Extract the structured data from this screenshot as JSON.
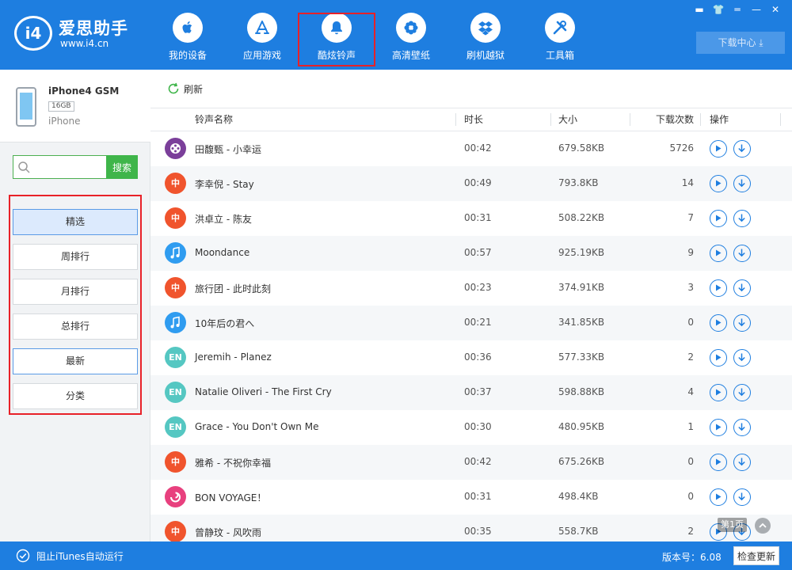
{
  "brand": {
    "badge": "i4",
    "name": "爱思助手",
    "url": "www.i4.cn"
  },
  "nav": [
    {
      "label": "我的设备",
      "icon": "apple-icon"
    },
    {
      "label": "应用游戏",
      "icon": "app-store-icon"
    },
    {
      "label": "酷炫铃声",
      "icon": "bell-icon",
      "active": true
    },
    {
      "label": "高清壁纸",
      "icon": "flower-icon"
    },
    {
      "label": "刷机越狱",
      "icon": "dropbox-icon"
    },
    {
      "label": "工具箱",
      "icon": "tools-icon"
    }
  ],
  "window_controls": [
    "▬",
    "👕",
    "═",
    "—",
    "✕"
  ],
  "download_center": "下载中心 ⤓",
  "device": {
    "name": "iPhone4 GSM",
    "capacity": "16GB",
    "type": "iPhone"
  },
  "search": {
    "placeholder": "",
    "button": "搜索"
  },
  "categories": [
    "精选",
    "周排行",
    "月排行",
    "总排行",
    "最新",
    "分类"
  ],
  "refresh_label": "刷新",
  "table": {
    "headers": {
      "name": "铃声名称",
      "duration": "时长",
      "size": "大小",
      "downloads": "下载次数",
      "actions": "操作"
    },
    "rows": [
      {
        "icon_type": "film",
        "name": "田馥甄 - 小幸运",
        "duration": "00:42",
        "size": "679.58KB",
        "downloads": "5726"
      },
      {
        "icon_type": "zh",
        "name": "李幸倪 - Stay",
        "duration": "00:49",
        "size": "793.8KB",
        "downloads": "14"
      },
      {
        "icon_type": "zh",
        "name": "洪卓立 - 陈友",
        "duration": "00:31",
        "size": "508.22KB",
        "downloads": "7"
      },
      {
        "icon_type": "music",
        "name": "Moondance",
        "duration": "00:57",
        "size": "925.19KB",
        "downloads": "9"
      },
      {
        "icon_type": "zh",
        "name": "旅行团 - 此时此刻",
        "duration": "00:23",
        "size": "374.91KB",
        "downloads": "3"
      },
      {
        "icon_type": "music",
        "name": "10年后の君へ",
        "duration": "00:21",
        "size": "341.85KB",
        "downloads": "0"
      },
      {
        "icon_type": "en",
        "name": "Jeremih - Planez",
        "duration": "00:36",
        "size": "577.33KB",
        "downloads": "2"
      },
      {
        "icon_type": "en",
        "name": "Natalie Oliveri - The First Cry",
        "duration": "00:37",
        "size": "598.88KB",
        "downloads": "4"
      },
      {
        "icon_type": "en",
        "name": "Grace - You Don't Own Me",
        "duration": "00:30",
        "size": "480.95KB",
        "downloads": "1"
      },
      {
        "icon_type": "zh",
        "name": "雅希 - 不祝你幸福",
        "duration": "00:42",
        "size": "675.26KB",
        "downloads": "0"
      },
      {
        "icon_type": "swirl",
        "name": "BON VOYAGE！",
        "duration": "00:31",
        "size": "498.4KB",
        "downloads": "0"
      },
      {
        "icon_type": "zh",
        "name": "曾静玟 - 风吹雨",
        "duration": "00:35",
        "size": "558.7KB",
        "downloads": "2"
      }
    ]
  },
  "icon_labels": {
    "zh": "中",
    "en": "EN"
  },
  "page_indicator": "第1页",
  "status": {
    "itunes_label": "阻止iTunes自动运行",
    "version": "版本号：6.08",
    "update_button": "检查更新"
  },
  "colors": {
    "primary": "#1e7ee0",
    "highlight": "#e82128",
    "search_green": "#3fb54a",
    "icon_red": "#f0542d",
    "icon_blue": "#2f9cf0",
    "icon_teal": "#55c7c2",
    "icon_purple": "#7b3f9a",
    "icon_pink": "#e8407e"
  }
}
